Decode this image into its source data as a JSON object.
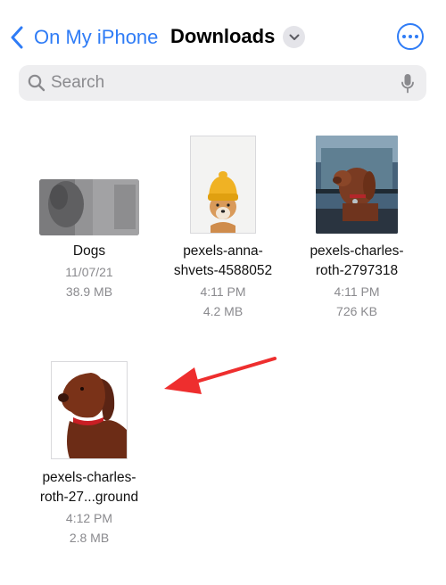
{
  "nav": {
    "back_label": "On My iPhone",
    "title": "Downloads"
  },
  "search": {
    "placeholder": "Search"
  },
  "files": [
    {
      "name_line1": "Dogs",
      "name_line2": "",
      "date": "11/07/21",
      "size": "38.9 MB",
      "kind": "folder"
    },
    {
      "name_line1": "pexels-anna-",
      "name_line2": "shvets-4588052",
      "date": "4:11 PM",
      "size": "4.2 MB",
      "kind": "image"
    },
    {
      "name_line1": "pexels-charles-",
      "name_line2": "roth-2797318",
      "date": "4:11 PM",
      "size": "726 KB",
      "kind": "image"
    },
    {
      "name_line1": "pexels-charles-",
      "name_line2": "roth-27...ground",
      "date": "4:12 PM",
      "size": "2.8 MB",
      "kind": "image"
    }
  ],
  "colors": {
    "accent": "#2f7cf6",
    "annotation_arrow": "#ee2e2e",
    "secondary_text": "#8a8a8e"
  },
  "icons": [
    "back-chevron-icon",
    "chevron-down-icon",
    "more-icon",
    "search-icon",
    "mic-icon"
  ]
}
